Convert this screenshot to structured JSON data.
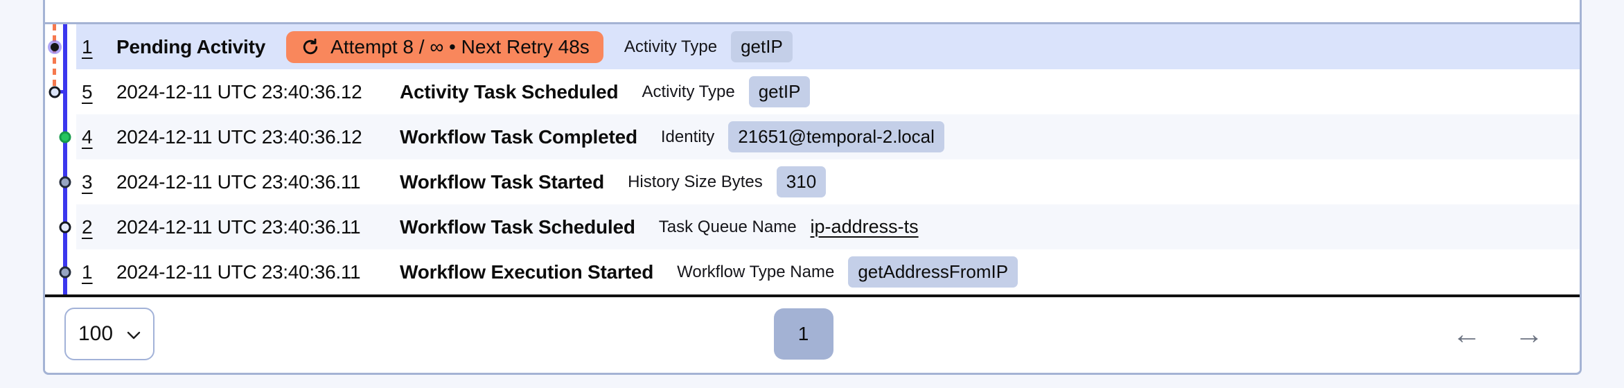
{
  "colors": {
    "page_background": "#f4f6fc",
    "card_border": "#a4b3d4",
    "timeline_line": "#3b37ee",
    "pending_dashed_line": "#f5794e",
    "selected_row": "#dae3fb",
    "alt_row": "#f5f7fc",
    "attr_badge": "#c4cfe8",
    "retry_badge": "#f9875c",
    "success_marker": "#25c55f",
    "neutral_marker": "#97a5c2",
    "pagination_button": "#a3b2d4"
  },
  "events": [
    {
      "id": "1",
      "name": "Pending Activity",
      "marker": "pending-selected",
      "badge": {
        "icon": "retry-icon",
        "text": "Attempt 8 / ∞ • Next Retry 48s"
      },
      "attr": {
        "label": "Activity Type",
        "value": "getIP",
        "style": "badge"
      }
    },
    {
      "id": "5",
      "time": "2024-12-11 UTC 23:40:36.12",
      "name": "Activity Task Scheduled",
      "marker": "hollow-light",
      "attr": {
        "label": "Activity Type",
        "value": "getIP",
        "style": "badge"
      }
    },
    {
      "id": "4",
      "time": "2024-12-11 UTC 23:40:36.12",
      "name": "Workflow Task Completed",
      "marker": "green",
      "attr": {
        "label": "Identity",
        "value": "21651@temporal-2.local",
        "style": "badge"
      }
    },
    {
      "id": "3",
      "time": "2024-12-11 UTC 23:40:36.11",
      "name": "Workflow Task Started",
      "marker": "gray",
      "attr": {
        "label": "History Size Bytes",
        "value": "310",
        "style": "badge"
      }
    },
    {
      "id": "2",
      "time": "2024-12-11 UTC 23:40:36.11",
      "name": "Workflow Task Scheduled",
      "marker": "hollow-light",
      "attr": {
        "label": "Task Queue Name",
        "value": "ip-address-ts",
        "style": "link"
      }
    },
    {
      "id": "1",
      "time": "2024-12-11 UTC 23:40:36.11",
      "name": "Workflow Execution Started",
      "marker": "gray",
      "attr": {
        "label": "Workflow Type Name",
        "value": "getAddressFromIP",
        "style": "badge"
      }
    }
  ],
  "pagination": {
    "page_size": "100",
    "current_page": "1",
    "prev_icon": "←",
    "next_icon": "→"
  }
}
